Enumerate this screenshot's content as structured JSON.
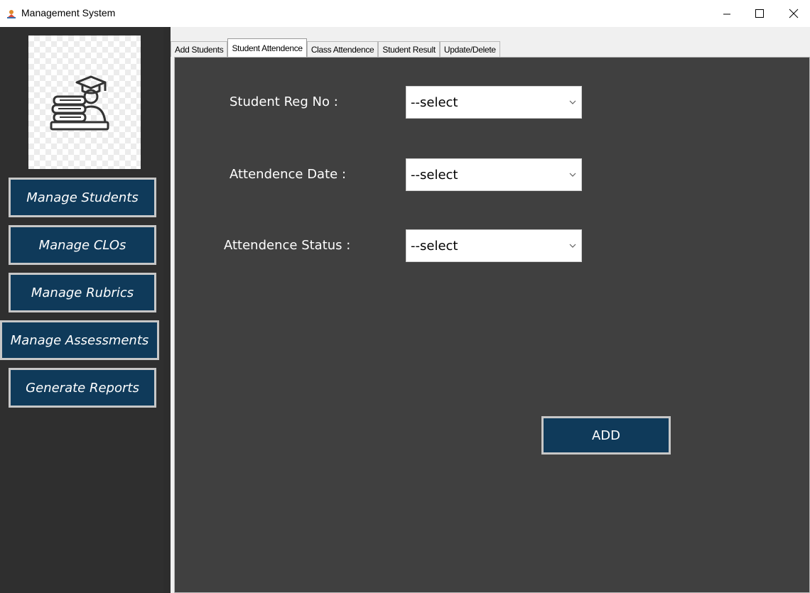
{
  "window": {
    "title": "Management System",
    "icon": "app-icon",
    "controls": {
      "minimize": "minimize-icon",
      "maximize": "maximize-icon",
      "close": "close-icon"
    }
  },
  "sidebar": {
    "logo": "student-books-icon",
    "buttons": [
      {
        "label": "Manage Students"
      },
      {
        "label": "Manage CLOs"
      },
      {
        "label": "Manage Rubrics"
      },
      {
        "label": "Manage Assessments"
      },
      {
        "label": "Generate Reports"
      }
    ]
  },
  "tabs": [
    {
      "label": "Add Students",
      "active": false
    },
    {
      "label": "Student Attendence",
      "active": true
    },
    {
      "label": "Class Attendence",
      "active": false
    },
    {
      "label": "Student Result",
      "active": false
    },
    {
      "label": "Update/Delete",
      "active": false
    }
  ],
  "form": {
    "reg_no": {
      "label": "Student Reg No :",
      "value": "--select"
    },
    "date": {
      "label": "Attendence Date :",
      "value": "--select"
    },
    "status": {
      "label": "Attendence Status :",
      "value": "--select"
    },
    "add_label": "ADD"
  },
  "colors": {
    "button_bg": "#0f3a5a",
    "panel_bg": "#404040",
    "sidebar_bg": "#2f2f2f"
  }
}
